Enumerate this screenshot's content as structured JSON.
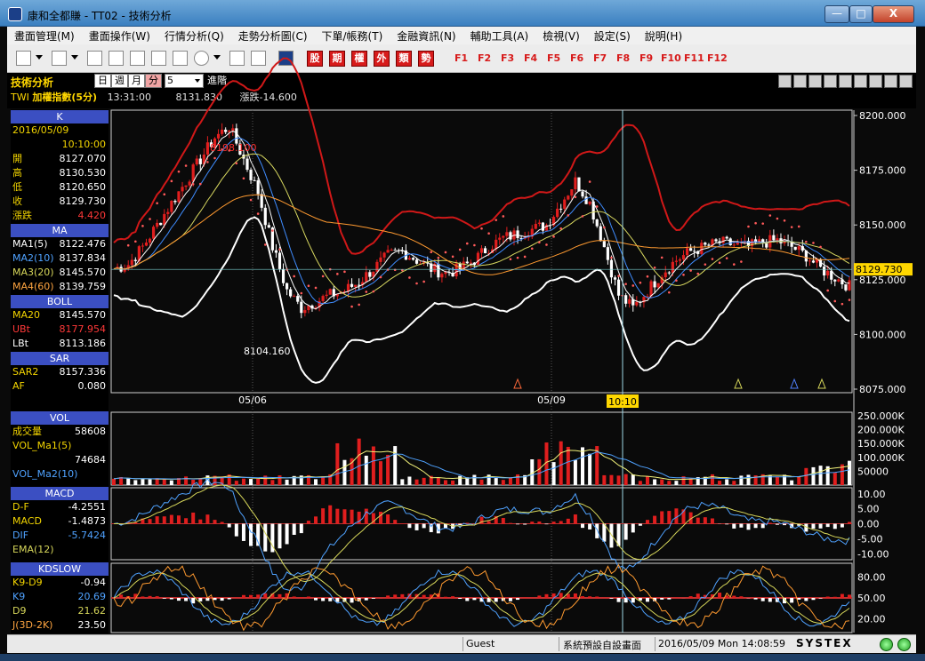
{
  "window": {
    "title": "康和全都賺 - TT02 - 技術分析",
    "min_glyph": "—",
    "max_glyph": "□",
    "close_glyph": "X"
  },
  "menu": [
    "畫面管理(M)",
    "畫面操作(W)",
    "行情分析(Q)",
    "走勢分析圖(C)",
    "下單/帳務(T)",
    "金融資訊(N)",
    "輔助工具(A)",
    "檢視(V)",
    "設定(S)",
    "說明(H)"
  ],
  "toolbar": {
    "quick_buttons": [
      "股",
      "期",
      "權",
      "外",
      "類",
      "勢"
    ],
    "fkeys": [
      "F1",
      "F2",
      "F3",
      "F4",
      "F5",
      "F6",
      "F7",
      "F8",
      "F9",
      "F10",
      "F11",
      "F12"
    ]
  },
  "panel": {
    "title": "技術分析",
    "period_tabs": [
      "日",
      "週",
      "月",
      "分"
    ],
    "interval": "5",
    "advanced": "進階",
    "symbol": "TWI",
    "name": "加權指數(5分)",
    "time": "13:31:00",
    "price": "8131.830",
    "change": "漲跌-14.600"
  },
  "sidebar": {
    "k": {
      "header": "K",
      "date": "2016/05/09",
      "time": "10:10:00",
      "rows": [
        {
          "label": "開",
          "value": "8127.070"
        },
        {
          "label": "高",
          "value": "8130.530"
        },
        {
          "label": "低",
          "value": "8120.650"
        },
        {
          "label": "收",
          "value": "8129.730"
        },
        {
          "label": "漲跌",
          "value": "4.420"
        }
      ]
    },
    "ma": {
      "header": "MA",
      "rows": [
        {
          "label": "MA1(5)",
          "value": "8122.476"
        },
        {
          "label": "MA2(10)",
          "value": "8137.834"
        },
        {
          "label": "MA3(20)",
          "value": "8145.570"
        },
        {
          "label": "MA4(60)",
          "value": "8139.759"
        }
      ]
    },
    "boll": {
      "header": "BOLL",
      "rows": [
        {
          "label": "MA20",
          "value": "8145.570"
        },
        {
          "label": "UBt",
          "value": "8177.954"
        },
        {
          "label": "LBt",
          "value": "8113.186"
        }
      ]
    },
    "sar": {
      "header": "SAR",
      "rows": [
        {
          "label": "SAR2",
          "value": "8157.336"
        },
        {
          "label": "AF",
          "value": "0.080"
        }
      ]
    },
    "vol": {
      "header": "VOL",
      "rows": [
        {
          "label": "成交量",
          "value": "58608"
        },
        {
          "label": "VOL_Ma1(5)",
          "value": ""
        },
        {
          "label": "",
          "value": "74684"
        },
        {
          "label": "VOL_Ma2(10)",
          "value": ""
        }
      ]
    },
    "macd": {
      "header": "MACD",
      "rows": [
        {
          "label": "D-F",
          "value": "-4.2551"
        },
        {
          "label": "MACD",
          "value": "-1.4873"
        },
        {
          "label": "DIF",
          "value": "-5.7424"
        },
        {
          "label": "EMA(12)",
          "value": ""
        }
      ]
    },
    "kd": {
      "header": "KDSLOW",
      "rows": [
        {
          "label": "K9-D9",
          "value": "-0.94"
        },
        {
          "label": "K9",
          "value": "20.69"
        },
        {
          "label": "D9",
          "value": "21.62"
        },
        {
          "label": "J(3D-2K)",
          "value": "23.50"
        }
      ]
    }
  },
  "status": {
    "user": "Guest",
    "layout": "系統預設自設畫面",
    "datetime": "2016/05/09 Mon 14:08:59",
    "brand": "SYSTEX"
  },
  "colors": {
    "up": "#e01e1e",
    "down": "#ffffff",
    "boll_upper": "#d01818",
    "boll_lower": "#ffffff",
    "ma5": "#ffffff",
    "ma10": "#3f8cff",
    "ma20": "#d8d860",
    "ma60": "#ff9a30",
    "sar": "#ff5a5a"
  },
  "chart_data": {
    "type": "candlestick",
    "x_labels": [
      "05/06",
      "05/09"
    ],
    "cursor_label": "10:10",
    "price_axis": {
      "ticks": [
        "8200.000",
        "8175.000",
        "8150.000",
        "8125.000",
        "8100.000",
        "8075.000"
      ],
      "range": [
        8075,
        8200
      ],
      "current": "8129.730"
    },
    "annotations": {
      "high": "8198.100",
      "low": "8104.160"
    },
    "volume_axis": {
      "ticks": [
        "250.000K",
        "200.000K",
        "150.000K",
        "100.000K",
        "50000"
      ],
      "range": [
        0,
        250000
      ]
    },
    "macd_axis": {
      "ticks": [
        "10.00",
        "5.00",
        "0.00",
        "-5.00",
        "-10.00"
      ],
      "range": [
        -12,
        12
      ]
    },
    "kd_axis": {
      "ticks": [
        "80.00",
        "50.00",
        "20.00"
      ],
      "range": [
        0,
        100
      ]
    }
  }
}
